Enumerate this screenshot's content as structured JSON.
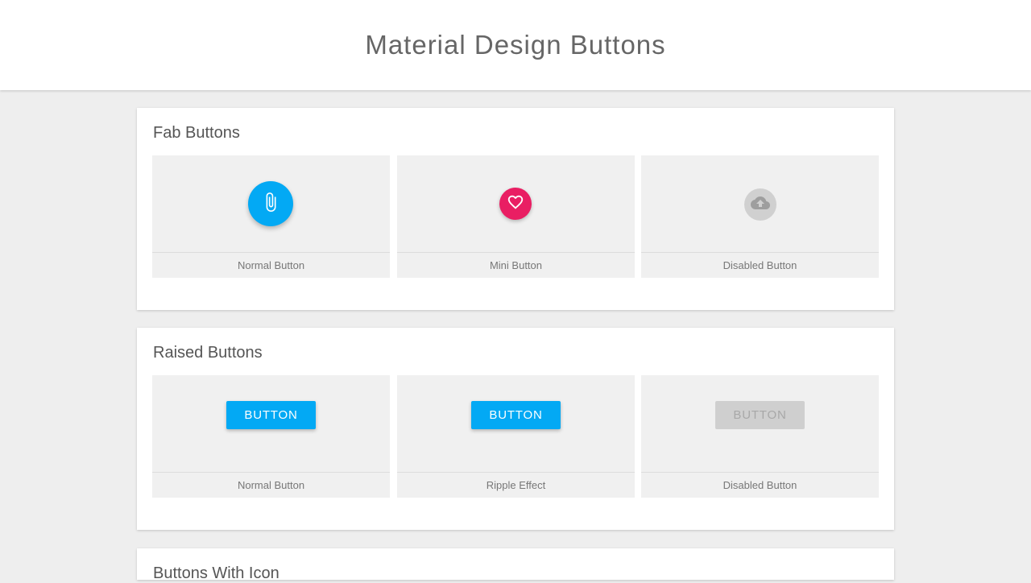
{
  "header": {
    "title": "Material Design Buttons"
  },
  "sections": [
    {
      "title": "Fab Buttons",
      "demos": [
        {
          "caption": "Normal Button",
          "icon": "paperclip-icon",
          "color": "#03a9f4"
        },
        {
          "caption": "Mini Button",
          "icon": "heart-icon",
          "color": "#e91e63"
        },
        {
          "caption": "Disabled Button",
          "icon": "cloud-upload-icon",
          "color": "#d0d0d0"
        }
      ]
    },
    {
      "title": "Raised Buttons",
      "demos": [
        {
          "caption": "Normal Button",
          "button_label": "BUTTON",
          "color": "#03a9f4"
        },
        {
          "caption": "Ripple Effect",
          "button_label": "BUTTON",
          "color": "#03a9f4"
        },
        {
          "caption": "Disabled Button",
          "button_label": "BUTTON",
          "color": "#cfcfcf"
        }
      ]
    },
    {
      "title": "Buttons With Icon"
    }
  ]
}
